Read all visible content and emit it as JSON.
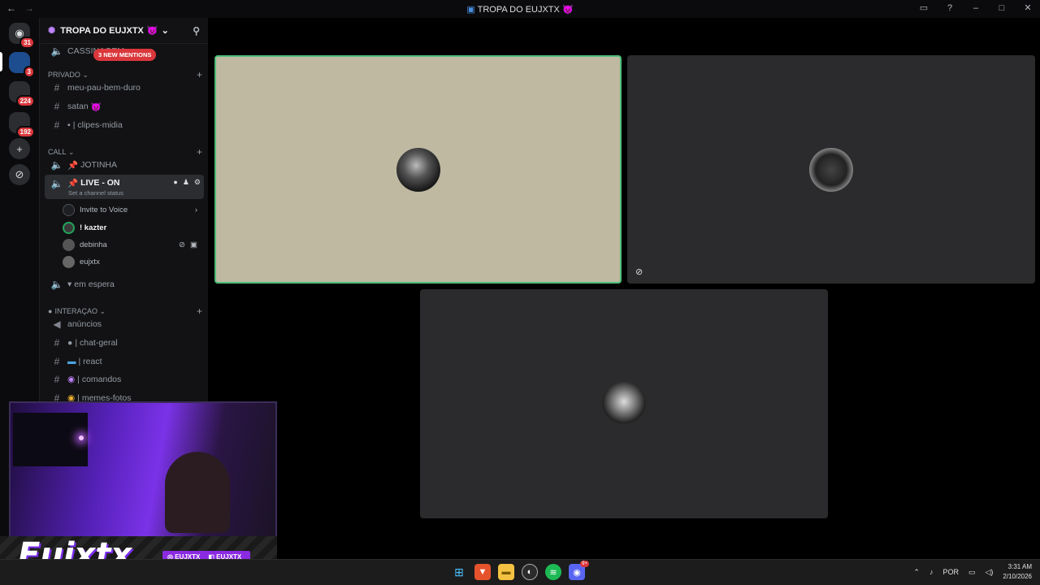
{
  "window": {
    "title": "TROPA DO EUJXTX",
    "title_emoji": "👿"
  },
  "guild_badges": [
    "31",
    "3",
    "224",
    "192"
  ],
  "server": {
    "name": "TROPA DO EUJXTX",
    "mentions_pill": "3 NEW MENTIONS",
    "top_channel": "CASSINAGEM"
  },
  "categories": {
    "privado": "PRIVADO",
    "call": "CALL",
    "interacao": "INTERAÇAO"
  },
  "channels": {
    "meu_pau": "meu-pau-bem-duro",
    "satan": "satan",
    "clipes": "| clipes-midia",
    "jotinha": "JOTINHA",
    "live_on": "LIVE - ON",
    "live_status": "Set a channel status",
    "em_espera": "em espera",
    "anuncios": "anúncios",
    "chat_geral": "| chat-geral",
    "react": "| react",
    "comandos": "| comandos",
    "memes": "| memes-fotos"
  },
  "voice_users": {
    "invite": "Invite to Voice",
    "kazter": "! kazter",
    "debinha": "debinha",
    "eujxtx": "eujxtx"
  },
  "overlay": {
    "brand": "Eujxtx",
    "instagram": "EUJXTX",
    "twitch": "EUJXTX_"
  },
  "taskbar": {
    "discord_badge": "9+",
    "lang": "POR",
    "time": "3:31 AM",
    "date": "2/10/2026"
  },
  "colors": {
    "speaking_border": "#4fbf7a",
    "tile1_bg": "#bfb9a2",
    "tile_bg": "#2b2b2d",
    "mention_red": "#da373c",
    "brand_purple": "#8a2be2"
  }
}
